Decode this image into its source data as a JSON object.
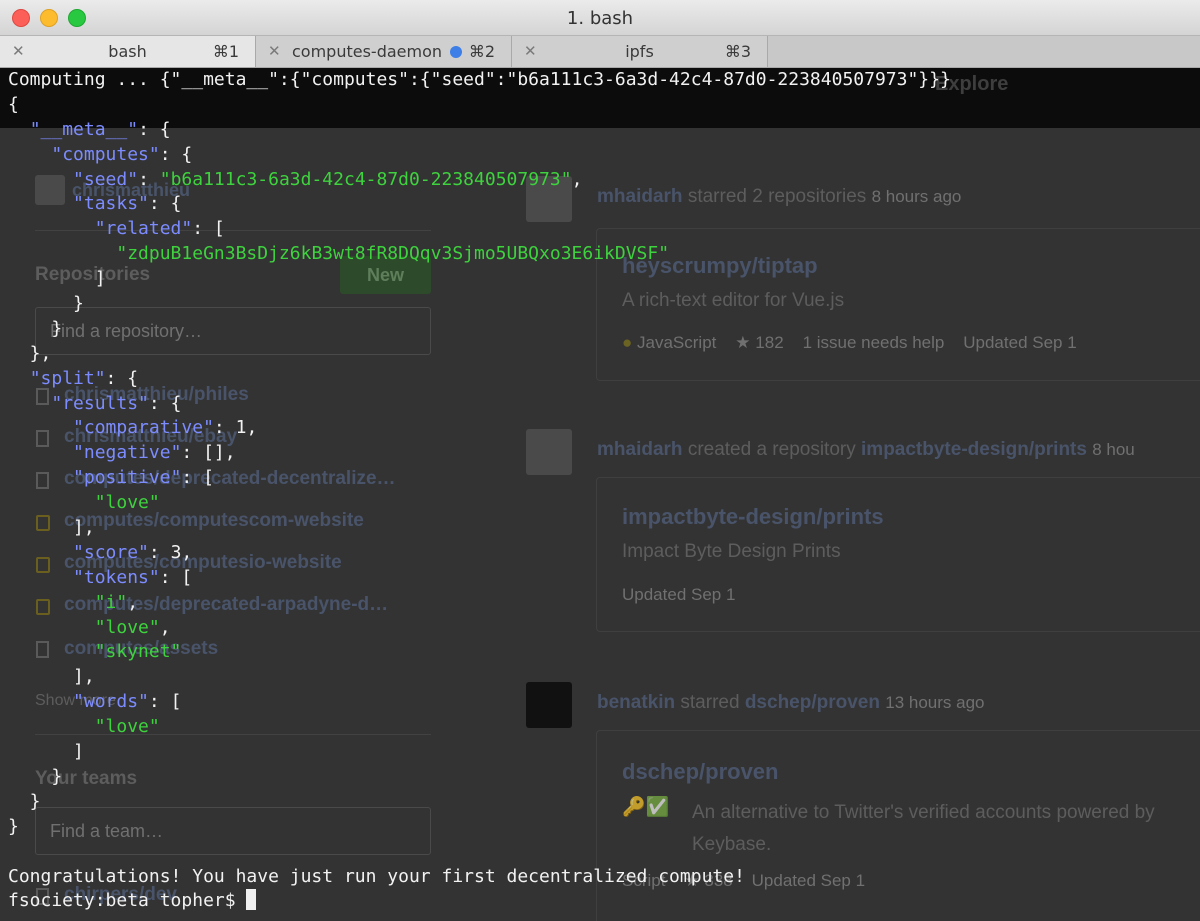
{
  "window": {
    "title": "1. bash"
  },
  "tabs": [
    {
      "label": "bash",
      "shortcut": "⌘1",
      "active": true
    },
    {
      "label": "computes-daemon",
      "shortcut": "⌘2",
      "active": false,
      "activity": true
    },
    {
      "label": "ipfs",
      "shortcut": "⌘3",
      "active": false
    }
  ],
  "terminal": {
    "lines": [
      "Computing ... {\"__meta__\":{\"computes\":{\"seed\":\"b6a111c3-6a3d-42c4-87d0-223840507973\"}}}",
      "{",
      "  \"__meta__\": {",
      "    \"computes\": {",
      "      \"seed\": \"b6a111c3-6a3d-42c4-87d0-223840507973\",",
      "      \"tasks\": {",
      "        \"related\": [",
      "          \"zdpuB1eGn3BsDjz6kB3wt8fR8DQqv3Sjmo5UBQxo3E6ikDVSF\"",
      "        ]",
      "      }",
      "    }",
      "  },",
      "  \"split\": {",
      "    \"results\": {",
      "      \"comparative\": 1,",
      "      \"negative\": [],",
      "      \"positive\": [",
      "        \"love\"",
      "      ],",
      "      \"score\": 3,",
      "      \"tokens\": [",
      "        \"i\",",
      "        \"love\",",
      "        \"skynet\"",
      "      ],",
      "      \"words\": [",
      "        \"love\"",
      "      ]",
      "    }",
      "  }",
      "}",
      "",
      "Congratulations! You have just run your first decentralized compute!",
      "fsociety:beta topher$ "
    ],
    "prompt": "fsociety:beta topher$ "
  },
  "colors": {
    "terminal_text": "#f2f2f2",
    "json_key": "#7c8cff",
    "json_string": "#3ed23e",
    "activity_dot": "#3d7fe6"
  },
  "background_page": {
    "nav": [
      "Explore"
    ],
    "user": "chrismatthieu",
    "repositories_heading": "Repositories",
    "new_button": "New",
    "find_repo_placeholder": "Find a repository…",
    "repos": [
      {
        "name": "chrismatthieu/philes",
        "private": false
      },
      {
        "name": "chrismatthieu/ebay",
        "private": false
      },
      {
        "name": "computes/deprecated-decentralize…",
        "private": false
      },
      {
        "name": "computes/computescom-website",
        "private": true
      },
      {
        "name": "computes/computesio-website",
        "private": true
      },
      {
        "name": "computes/deprecated-arpadyne-d…",
        "private": true
      },
      {
        "name": "computes/assets",
        "private": false
      }
    ],
    "show_more": "Show more",
    "teams_heading": "Your teams",
    "find_team_placeholder": "Find a team…",
    "team": "chirpers/dev",
    "feed": [
      {
        "actor": "mhaidarh",
        "action": "starred 2 repositories",
        "time": "8 hours ago",
        "repo": "heyscrumpy/tiptap",
        "description": "A rich-text editor for Vue.js",
        "language": "JavaScript",
        "stars": "182",
        "issues": "1 issue needs help",
        "updated": "Updated Sep 1"
      },
      {
        "actor": "mhaidarh",
        "action": "created a repository",
        "target": "impactbyte-design/prints",
        "time": "8 hou",
        "repo": "impactbyte-design/prints",
        "description": "Impact Byte Design Prints",
        "updated": "Updated Sep 1"
      },
      {
        "actor": "benatkin",
        "action": "starred",
        "target": "dschep/proven",
        "time": "13 hours ago",
        "repo": "dschep/proven",
        "emoji": "🔑✅",
        "description": "An alternative to Twitter's verified accounts powered by Keybase.",
        "language": "Script",
        "stars": "338",
        "updated": "Updated Sep 1"
      }
    ]
  }
}
